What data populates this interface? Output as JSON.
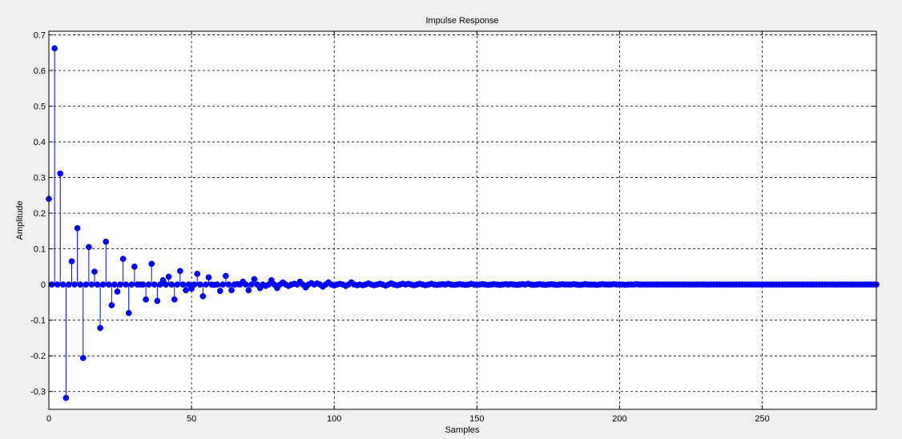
{
  "chart_data": {
    "type": "stem",
    "title": "Impulse Response",
    "xlabel": "Samples",
    "ylabel": "Amplitude",
    "xlim": [
      0,
      290
    ],
    "ylim": [
      -0.35,
      0.71
    ],
    "xticks": [
      0,
      50,
      100,
      150,
      200,
      250
    ],
    "yticks": [
      0.7,
      0.6,
      0.5,
      0.4,
      0.3,
      0.2,
      0.1,
      0,
      -0.1,
      -0.2,
      -0.3
    ],
    "grid": true,
    "colors": {
      "stem": "#0000ff",
      "axes_bg": "#ffffff",
      "figure_bg": "#f0f0f0",
      "grid": "#000000"
    },
    "series": [
      {
        "x": [
          0,
          2,
          4,
          6,
          8,
          10,
          12,
          14,
          16,
          18,
          20,
          22,
          24,
          26,
          28,
          30,
          32,
          34,
          36,
          38,
          40,
          42,
          44,
          46,
          48,
          50,
          52,
          54,
          56,
          58,
          60,
          62,
          64,
          66,
          68,
          70,
          72,
          74,
          76,
          78,
          80,
          82,
          84,
          86,
          88,
          90,
          92,
          94,
          96,
          98,
          100,
          102,
          104,
          106,
          108,
          110,
          112,
          114,
          116,
          118,
          120,
          122,
          124,
          126,
          128,
          130,
          132,
          134,
          136,
          138,
          140,
          142,
          144,
          146,
          148,
          150,
          152,
          154,
          156,
          158,
          160,
          162,
          164,
          166,
          168,
          170,
          172,
          174,
          176,
          178,
          180,
          182,
          184,
          186,
          188,
          190,
          192,
          194,
          196,
          198,
          200,
          202,
          204,
          206,
          208,
          210,
          212,
          214,
          216,
          218,
          220,
          222,
          224,
          226,
          228,
          230,
          232,
          234,
          236,
          238,
          240,
          242,
          244,
          246,
          248,
          250,
          252,
          254,
          256,
          258,
          260,
          262,
          264,
          266,
          268,
          270,
          272,
          274,
          276,
          278,
          280,
          282,
          284,
          286,
          288,
          290
        ],
        "y": [
          0.24,
          0.662,
          0.311,
          -0.318,
          0.065,
          0.158,
          -0.206,
          0.105,
          0.036,
          -0.122,
          0.12,
          -0.058,
          -0.02,
          0.072,
          -0.08,
          0.05,
          0.0,
          -0.042,
          0.058,
          -0.046,
          0.012,
          0.022,
          -0.042,
          0.038,
          -0.016,
          -0.012,
          0.03,
          -0.033,
          0.02,
          -0.001,
          -0.018,
          0.024,
          -0.016,
          0.001,
          0.008,
          -0.016,
          0.015,
          -0.01,
          -0.004,
          0.012,
          -0.01,
          0.006,
          -0.004,
          0.002,
          0.008,
          -0.008,
          0.004,
          0.003,
          -0.006,
          0.006,
          -0.003,
          0.002,
          -0.004,
          0.006,
          -0.002,
          -0.002,
          0.003,
          -0.002,
          0.002,
          -0.003,
          0.003,
          -0.002,
          0.002,
          0.002,
          -0.002,
          0.002,
          -0.002,
          0.002,
          -0.001,
          0.001,
          0.002,
          -0.001,
          0.001,
          -0.001,
          0.002,
          -0.001,
          0.001,
          -0.001,
          0.001,
          -0.001,
          0.001,
          0.001,
          -0.001,
          0.001,
          0.002,
          -0.001,
          0.001,
          -0.001,
          0.001,
          -0.001,
          0.001,
          0.0,
          0.001,
          -0.001,
          0.001,
          0.0,
          -0.001,
          0.001,
          0.0,
          0.001,
          0.0,
          -0.001,
          0.0,
          0.001,
          0.0,
          0.0,
          0.0,
          0.0,
          0.0,
          0.0,
          0.0,
          0.0,
          0.0,
          0.0,
          0.0,
          0.0,
          0.0,
          0.0,
          0.0,
          0.0,
          0.0,
          0.0,
          0.0,
          0.0,
          0.0,
          0.0,
          0.0,
          0.0,
          0.0,
          0.0,
          0.0,
          0.0,
          0.0,
          0.0,
          0.0,
          0.0,
          0.0,
          0.0,
          0.0,
          0.0,
          0.0,
          0.0,
          0.0,
          0.0,
          0.0,
          0.0
        ]
      },
      {
        "x": [
          1,
          3,
          5,
          7,
          9,
          11,
          13,
          15,
          17,
          19,
          21,
          23,
          25,
          27,
          29,
          31,
          33,
          35,
          37,
          39,
          41,
          43,
          45,
          47,
          49,
          51,
          53,
          55,
          57,
          59,
          61,
          63,
          65,
          67,
          69,
          71,
          73,
          75,
          77,
          79,
          81,
          83,
          85,
          87,
          89,
          91,
          93,
          95,
          97,
          99,
          101,
          103,
          105,
          107,
          109,
          111,
          113,
          115,
          117,
          119,
          121,
          123,
          125,
          127,
          129,
          131,
          133,
          135,
          137,
          139,
          141,
          143,
          145,
          147,
          149,
          151,
          153,
          155,
          157,
          159,
          161,
          163,
          165,
          167,
          169,
          171,
          173,
          175,
          177,
          179,
          181,
          183,
          185,
          187,
          189,
          191,
          193,
          195,
          197,
          199,
          201,
          203,
          205,
          207,
          209,
          211,
          213,
          215,
          217,
          219,
          221,
          223,
          225,
          227,
          229,
          231,
          233,
          235,
          237,
          239,
          241,
          243,
          245,
          247,
          249,
          251,
          253,
          255,
          257,
          259,
          261,
          263,
          265,
          267,
          269,
          271,
          273,
          275,
          277,
          279,
          281,
          283,
          285,
          287,
          289
        ],
        "y": [
          0.0,
          0.0,
          0.0,
          0.0,
          0.0,
          0.0,
          0.0,
          0.0,
          0.0,
          0.0,
          0.0,
          0.0,
          0.0,
          0.0,
          0.0,
          0.0,
          0.0,
          0.0,
          0.0,
          0.0,
          0.0,
          0.0,
          0.0,
          0.0,
          0.0,
          0.0,
          0.0,
          0.0,
          0.0,
          0.0,
          0.0,
          0.0,
          0.0,
          0.0,
          0.0,
          0.0,
          0.0,
          0.0,
          0.0,
          0.0,
          0.0,
          0.0,
          0.0,
          0.0,
          0.0,
          0.0,
          0.0,
          0.0,
          0.0,
          0.0,
          0.0,
          0.0,
          0.0,
          0.0,
          0.0,
          0.0,
          0.0,
          0.0,
          0.0,
          0.0,
          0.0,
          0.0,
          0.0,
          0.0,
          0.0,
          0.0,
          0.0,
          0.0,
          0.0,
          0.0,
          0.0,
          0.0,
          0.0,
          0.0,
          0.0,
          0.0,
          0.0,
          0.0,
          0.0,
          0.0,
          0.0,
          0.0,
          0.0,
          0.0,
          0.0,
          0.0,
          0.0,
          0.0,
          0.0,
          0.0,
          0.0,
          0.0,
          0.0,
          0.0,
          0.0,
          0.0,
          0.0,
          0.0,
          0.0,
          0.0,
          0.0,
          0.0,
          0.0,
          0.0,
          0.0,
          0.0,
          0.0,
          0.0,
          0.0,
          0.0,
          0.0,
          0.0,
          0.0,
          0.0,
          0.0,
          0.0,
          0.0,
          0.0,
          0.0,
          0.0,
          0.0,
          0.0,
          0.0,
          0.0,
          0.0,
          0.0,
          0.0,
          0.0,
          0.0,
          0.0,
          0.0,
          0.0,
          0.0,
          0.0,
          0.0,
          0.0,
          0.0,
          0.0,
          0.0,
          0.0,
          0.0,
          0.0,
          0.0,
          0.0,
          0.0
        ]
      }
    ]
  }
}
